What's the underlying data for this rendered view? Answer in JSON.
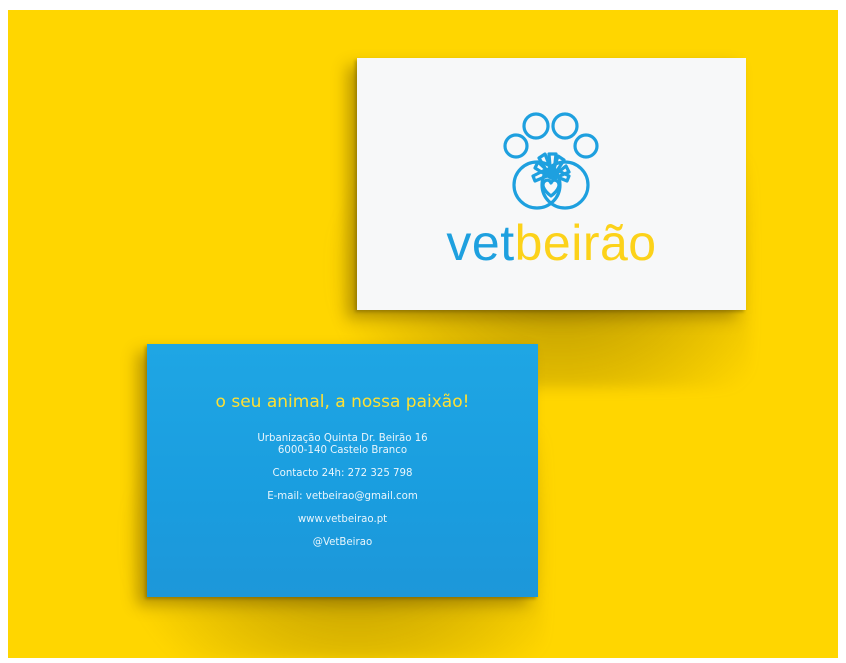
{
  "scene": {
    "background_color": "#ffd600",
    "front_card": {
      "background_color": "#f7f8f9",
      "logo": {
        "icon": "paw-heart-flower-icon",
        "wordmark_part1": "vet",
        "wordmark_part2": "beirão",
        "color_primary": "#1ea0df",
        "color_secondary": "#fcd21a"
      }
    },
    "back_card": {
      "background_color": "#1fa6e4",
      "tagline": "o seu animal, a nossa paixão!",
      "tagline_color": "#ffe033",
      "address_line1": "Urbanização Quinta Dr. Beirão 16",
      "address_line2": "6000-140 Castelo Branco",
      "phone": "Contacto 24h: 272 325 798",
      "email": "E-mail: vetbeirao@gmail.com",
      "website": "www.vetbeirao.pt",
      "social": "@VetBeirao"
    }
  }
}
